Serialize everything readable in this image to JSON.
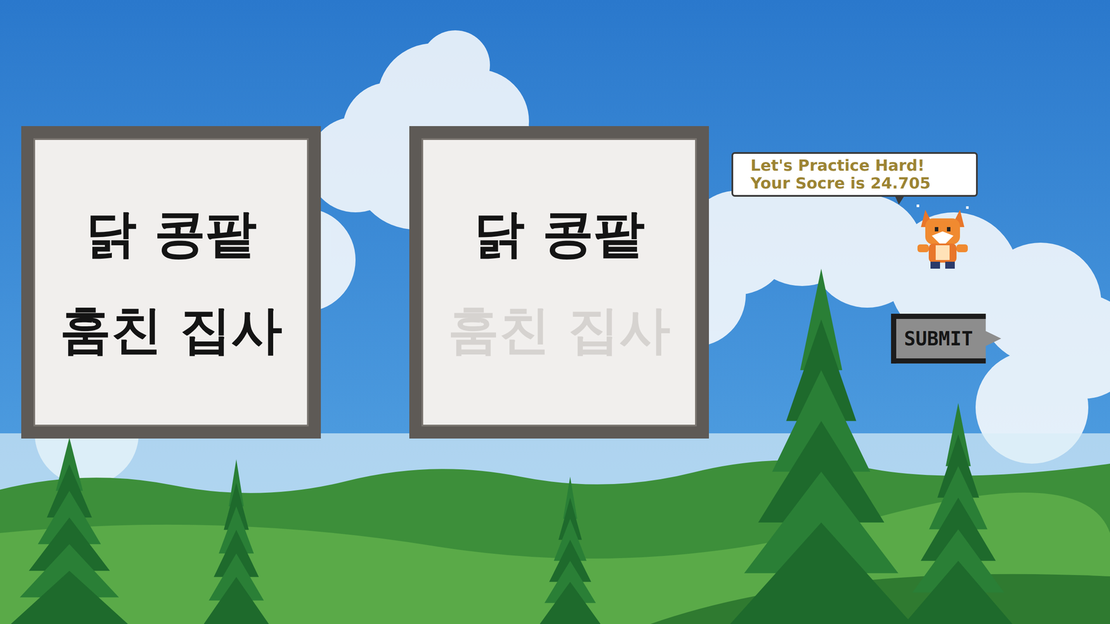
{
  "cards": [
    {
      "lines": [
        {
          "text": "닭 콩팥",
          "traced": true
        },
        {
          "text": "훔친 집사",
          "traced": true
        }
      ]
    },
    {
      "lines": [
        {
          "text": "닭 콩팥",
          "traced": true
        },
        {
          "text": "훔친 집사",
          "traced": false
        }
      ]
    }
  ],
  "speech": {
    "lines": [
      "Let's Practice Hard!",
      "Your Socre is 24.705"
    ]
  },
  "submit_button": {
    "label": "SUBMIT"
  }
}
